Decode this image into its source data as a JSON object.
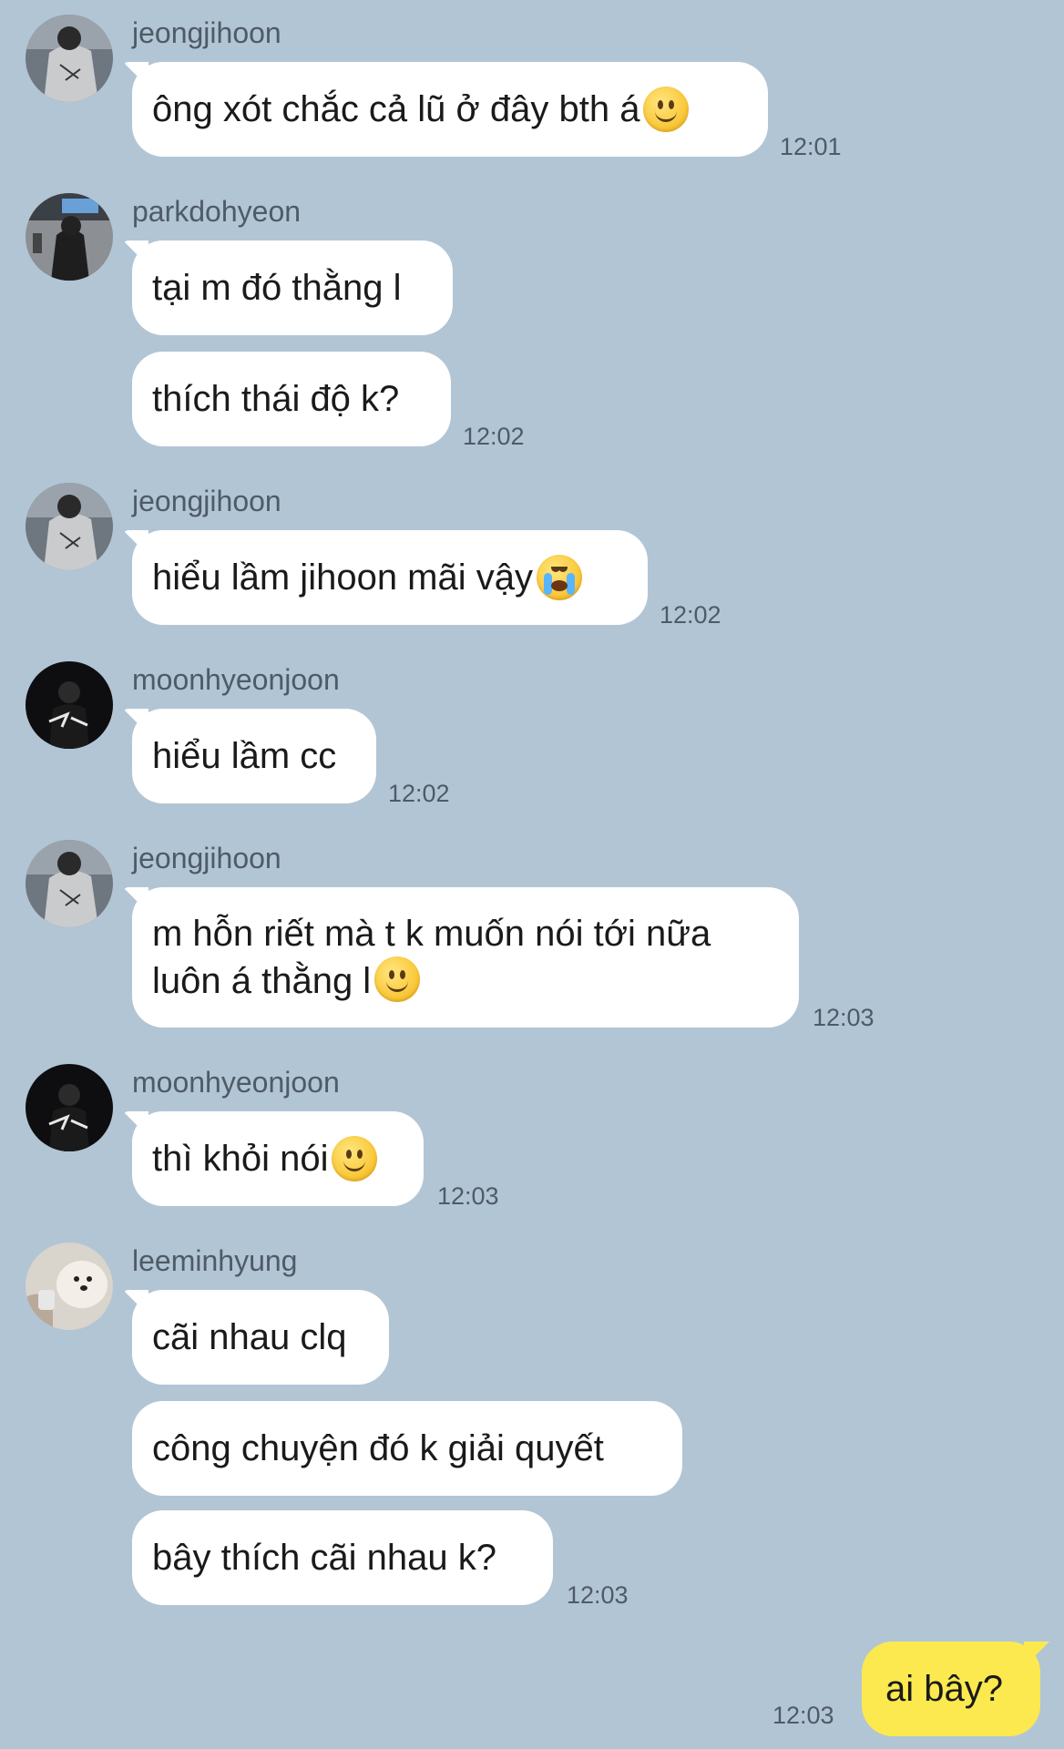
{
  "colors": {
    "background": "#b2c5d5",
    "bubble_in": "#ffffff",
    "bubble_out": "#fce94f",
    "meta_text": "#4e5b66"
  },
  "messages": [
    {
      "sender": "jeongjihoon",
      "avatar": "user-avatar",
      "lines": [
        "ông xót chắc cả lũ ở đây bth á"
      ],
      "emoji": "slightly-smiling-face-emoji",
      "time": "12:01"
    },
    {
      "sender": "parkdohyeon",
      "avatar": "user-avatar",
      "lines": [
        "tại m đó thằng l",
        "thích thái độ k?"
      ],
      "time": "12:02"
    },
    {
      "sender": "jeongjihoon",
      "avatar": "user-avatar",
      "lines": [
        "hiểu lầm jihoon mãi vậy"
      ],
      "emoji": "loudly-crying-face-emoji",
      "time": "12:02"
    },
    {
      "sender": "moonhyeonjoon",
      "avatar": "user-avatar",
      "lines": [
        "hiểu lầm cc"
      ],
      "time": "12:02"
    },
    {
      "sender": "jeongjihoon",
      "avatar": "user-avatar",
      "lines": [
        "m hỗn riết mà t k muốn nói tới nữa luôn á thằng l"
      ],
      "emoji": "slightly-smiling-face-emoji",
      "time": "12:03"
    },
    {
      "sender": "moonhyeonjoon",
      "avatar": "user-avatar",
      "lines": [
        "thì khỏi nói"
      ],
      "emoji": "slightly-smiling-face-emoji",
      "time": "12:03"
    },
    {
      "sender": "leeminhyung",
      "avatar": "user-avatar",
      "lines": [
        "cãi nhau clq",
        "công chuyện đó k giải quyết",
        "bây thích cãi nhau k?"
      ],
      "time": "12:03"
    }
  ],
  "outgoing": {
    "text": "ai bây?",
    "time": "12:03"
  }
}
